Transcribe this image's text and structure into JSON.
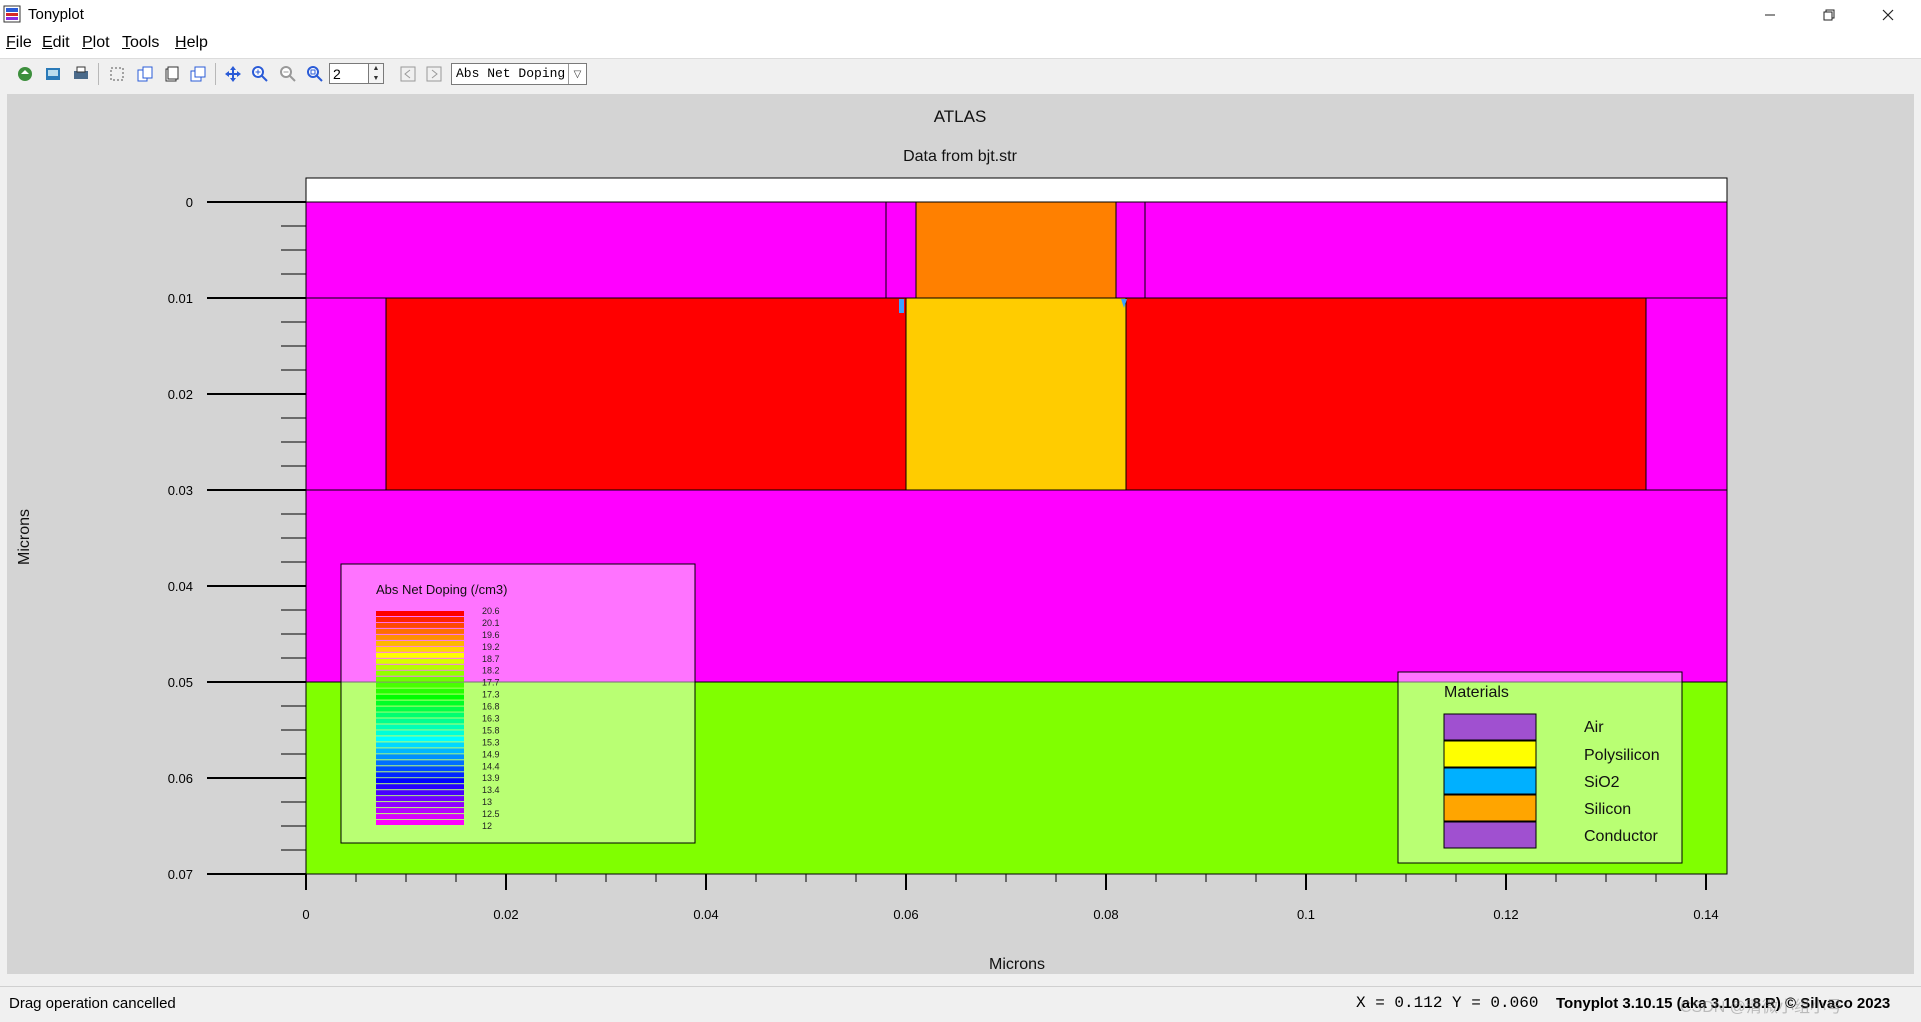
{
  "window": {
    "title": "Tonyplot",
    "controls": [
      "minimize-icon",
      "restore-icon",
      "close-icon"
    ]
  },
  "menu": {
    "items": [
      {
        "label": "File",
        "accel": "F",
        "rest": "ile"
      },
      {
        "label": "Edit",
        "accel": "E",
        "rest": "dit"
      },
      {
        "label": "Plot",
        "accel": "P",
        "rest": "lot"
      },
      {
        "label": "Tools",
        "accel": "T",
        "rest": "ools"
      },
      {
        "label": "Help",
        "accel": "H",
        "rest": "elp"
      }
    ]
  },
  "toolbar": {
    "icons": [
      "load-icon",
      "save-image-icon",
      "print-icon",
      "select-region-icon",
      "copy-icon",
      "delete-icon",
      "duplicate-icon",
      "pan-icon",
      "zoom-in-icon",
      "zoom-out-icon",
      "zoom-box-icon",
      "prev-icon",
      "next-icon"
    ],
    "zoom_value": "2",
    "quantity_select": "Abs Net Doping"
  },
  "plot": {
    "title": "ATLAS",
    "subtitle": "Data from bjt.str",
    "xlabel": "Microns",
    "ylabel": "Microns",
    "x_ticks": [
      "0",
      "0.02",
      "0.04",
      "0.06",
      "0.08",
      "0.1",
      "0.12",
      "0.14"
    ],
    "y_ticks": [
      "0",
      "0.01",
      "0.02",
      "0.03",
      "0.04",
      "0.05",
      "0.06",
      "0.07"
    ],
    "colors": {
      "oxide_magenta": "#ff00ff",
      "doped_red": "#ff0000",
      "poly_orange": "#ff8000",
      "silicon_amber": "#ffcc00",
      "substrate_green": "#80ff00",
      "background": "#d4d4d4"
    }
  },
  "doping_legend": {
    "title": "Abs Net Doping (/cm3)",
    "levels": [
      "20.6",
      "20.1",
      "19.6",
      "19.2",
      "18.7",
      "18.2",
      "17.7",
      "17.3",
      "16.8",
      "16.3",
      "15.8",
      "15.3",
      "14.9",
      "14.4",
      "13.9",
      "13.4",
      "13",
      "12.5",
      "12"
    ]
  },
  "materials_legend": {
    "title": "Materials",
    "items": [
      {
        "name": "Air",
        "color": "#a050d0"
      },
      {
        "name": "Polysilicon",
        "color": "#ffff00"
      },
      {
        "name": "SiO2",
        "color": "#00b0ff"
      },
      {
        "name": "Silicon",
        "color": "#ffa500"
      },
      {
        "name": "Conductor",
        "color": "#a050d0"
      }
    ]
  },
  "status": {
    "message": "Drag operation cancelled",
    "coords": "X = 0.112 Y = 0.060",
    "version": "Tonyplot 3.10.15 (aka 3.10.18.R) © Silvaco 2023",
    "watermark": "CSDN @清微小组小号"
  }
}
